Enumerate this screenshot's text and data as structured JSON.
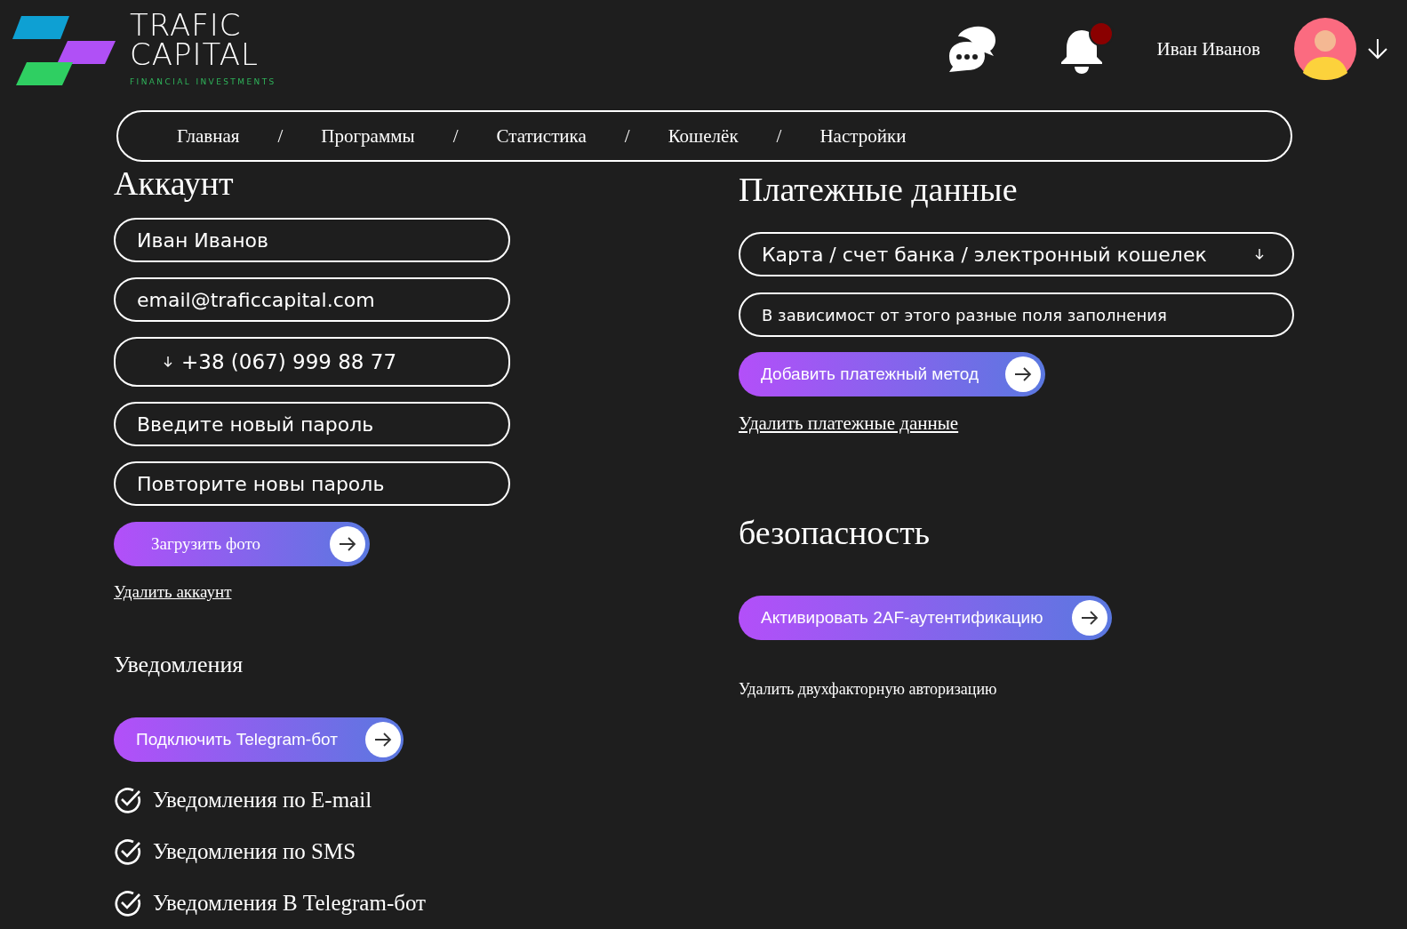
{
  "logo": {
    "line1": "TRAFIC",
    "line2": "CAPITAL",
    "tagline": "FINANCIAL INVESTMENTS"
  },
  "header": {
    "notifications_unread": true,
    "user_name": "Иван Иванов"
  },
  "nav": {
    "items": [
      "Главная",
      "Программы",
      "Статистика",
      "Кошелёк",
      "Настройки"
    ],
    "separators": [
      "/",
      "/",
      "/",
      "/"
    ]
  },
  "account": {
    "title": "Аккаунт",
    "fields": [
      {
        "kind": "text",
        "value": "Иван Иванов"
      },
      {
        "kind": "text",
        "value": "email@traficcapital.com"
      },
      {
        "kind": "phone",
        "value": "+38 (067) 999 88 77"
      },
      {
        "kind": "password",
        "placeholder": "Введите новый пароль"
      },
      {
        "kind": "password",
        "placeholder": "Повторите новы пароль"
      }
    ],
    "upload_button": "Загрузить фото",
    "delete_link": "Удалить аккаунт"
  },
  "notifications": {
    "title": "Уведомления",
    "telegram_button": "Подключить Telegram-бот",
    "options": [
      {
        "label": "Уведомления по E-mail",
        "checked": true
      },
      {
        "label": "Уведомления по SMS",
        "checked": true
      },
      {
        "label": "Уведомления В Telegram-бот",
        "checked": true
      }
    ]
  },
  "payment": {
    "title": "Платежные данные",
    "method_select": "Карта / счет банка / электронный кошелек",
    "details_placeholder": "В зависимост от этого разные поля заполнения",
    "add_button": "Добавить платежный метод",
    "delete_link": "Удалить платежные данные"
  },
  "security": {
    "title": "безопасность",
    "activate_button": "Активировать 2AF-аутентификацию",
    "remove_text": "Удалить двухфакторную авторизацию"
  }
}
